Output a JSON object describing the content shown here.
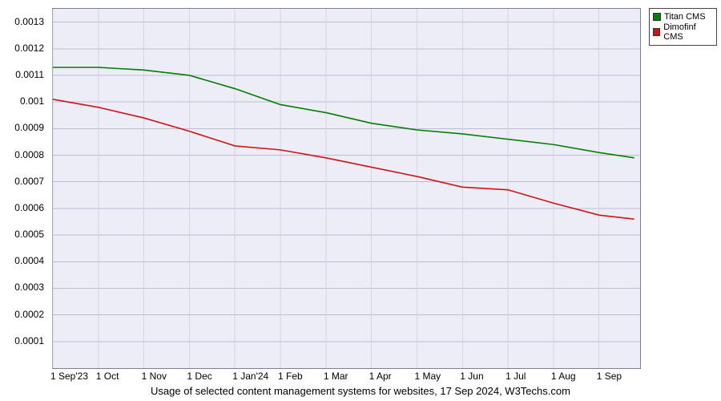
{
  "chart_data": {
    "type": "line",
    "title": "",
    "xlabel": "",
    "ylabel": "",
    "ylim": [
      0,
      0.00135
    ],
    "categories": [
      "1 Sep'23",
      "1 Oct",
      "1 Nov",
      "1 Dec",
      "1 Jan'24",
      "1 Feb",
      "1 Mar",
      "1 Apr",
      "1 May",
      "1 Jun",
      "1 Jul",
      "1 Aug",
      "1 Sep"
    ],
    "y_ticks": [
      0.0001,
      0.0002,
      0.0003,
      0.0004,
      0.0005,
      0.0006,
      0.0007,
      0.0008,
      0.0009,
      0.001,
      0.0011,
      0.0012,
      0.0013
    ],
    "series": [
      {
        "name": "Titan CMS",
        "color": "#008000",
        "values": [
          0.00113,
          0.00113,
          0.00112,
          0.0011,
          0.00105,
          0.00099,
          0.00096,
          0.00092,
          0.000895,
          0.00088,
          0.00086,
          0.00084,
          0.00081
        ]
      },
      {
        "name": "Dimofinf CMS",
        "color": "#d01414",
        "values": [
          0.00101,
          0.00098,
          0.00094,
          0.00089,
          0.000835,
          0.00082,
          0.00079,
          0.000755,
          0.00072,
          0.00068,
          0.00067,
          0.00062,
          0.000575
        ]
      }
    ],
    "series_end_values": [
      0.00079,
      0.00056
    ]
  },
  "caption": "Usage of selected content management systems for websites, 17 Sep 2024, W3Techs.com"
}
